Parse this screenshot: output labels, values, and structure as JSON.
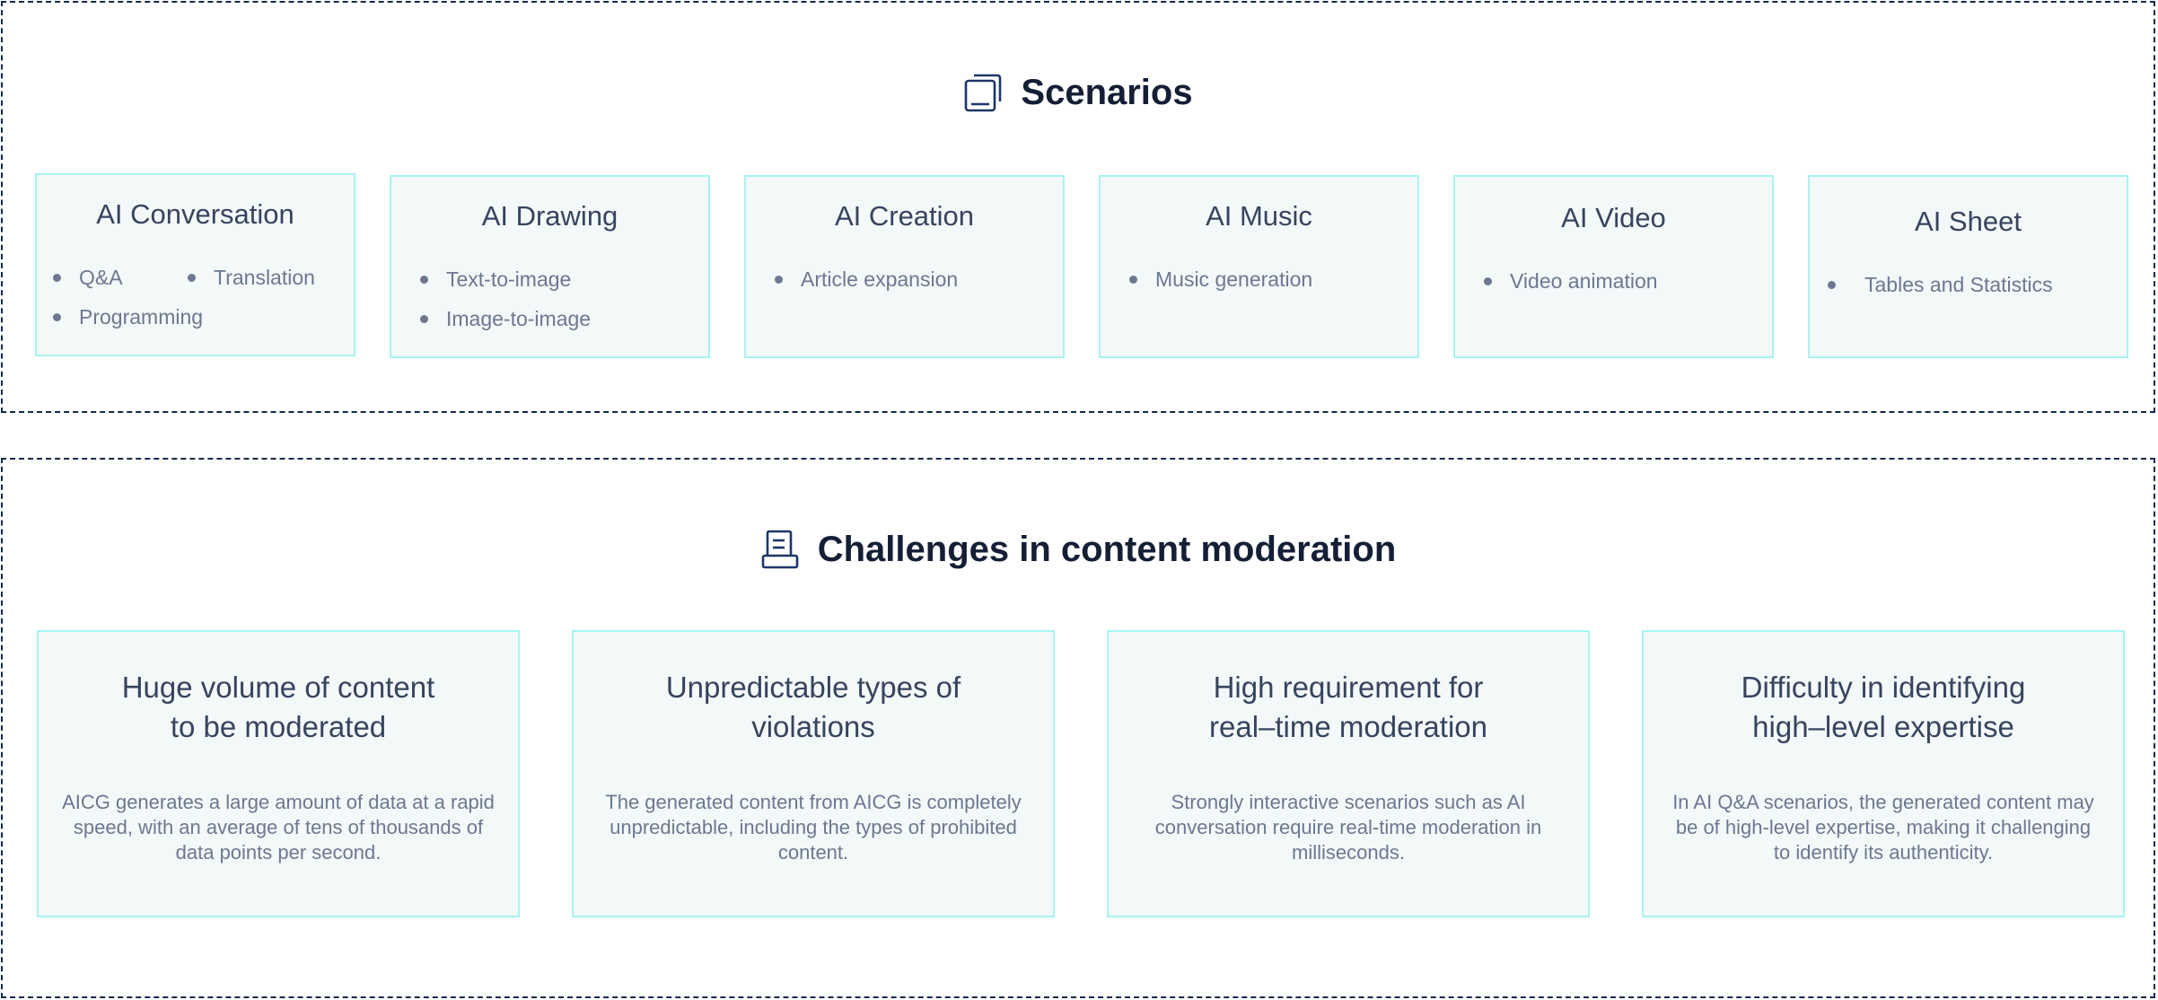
{
  "scenarios": {
    "title": "Scenarios",
    "icon": "layers-icon",
    "cards": [
      {
        "title": "AI Conversation",
        "items": [
          "Q&A",
          "Translation",
          "Programming"
        ]
      },
      {
        "title": "AI Drawing",
        "items": [
          "Text-to-image",
          "Image-to-image"
        ]
      },
      {
        "title": "AI Creation",
        "items": [
          "Article expansion"
        ]
      },
      {
        "title": "AI Music",
        "items": [
          "Music generation"
        ]
      },
      {
        "title": "AI Video",
        "items": [
          "Video animation"
        ]
      },
      {
        "title": "AI Sheet",
        "items": [
          "Tables and Statistics"
        ]
      }
    ]
  },
  "challenges": {
    "title": "Challenges in content moderation",
    "icon": "document-stack-icon",
    "cards": [
      {
        "title_line1": "Huge volume of content",
        "title_line2": "to be moderated",
        "description": "AICG generates a large amount of data at a rapid speed, with an average of tens of thousands of data points per second."
      },
      {
        "title_line1": "Unpredictable types of",
        "title_line2": "violations",
        "description": "The generated content from AICG is completely unpredictable, including the types of prohibited content."
      },
      {
        "title_line1": "High requirement for",
        "title_line2": "real–time moderation",
        "description": "Strongly interactive scenarios such as AI conversation require real-time moderation in milliseconds."
      },
      {
        "title_line1": "Difficulty in identifying",
        "title_line2": "high–level expertise",
        "description": "In AI Q&A scenarios, the generated content may be of high-level expertise, making it challenging to identify its authenticity."
      }
    ]
  },
  "colors": {
    "frame_border": "#13294b",
    "card_border": "#a8f3f0",
    "card_background": "#f3f8f9",
    "heading_text": "#141f36",
    "card_title_text": "#36445e",
    "body_text": "#6b7890"
  }
}
